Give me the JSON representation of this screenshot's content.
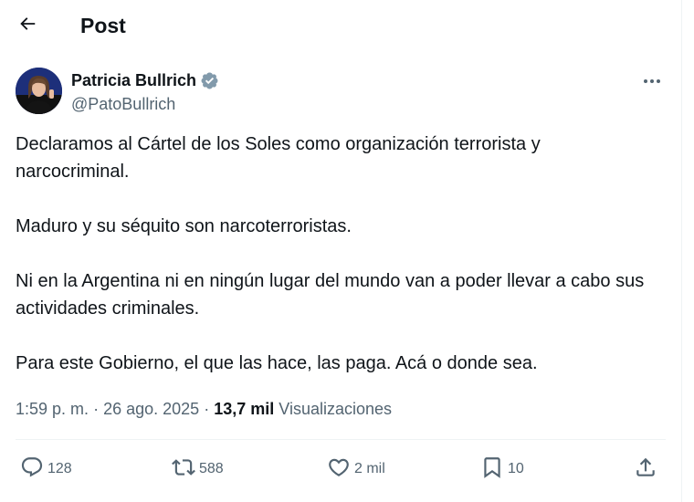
{
  "header": {
    "title": "Post"
  },
  "author": {
    "name": "Patricia Bullrich",
    "handle": "@PatoBullrich"
  },
  "tweet": {
    "paragraphs": [
      "Declaramos al Cártel de los Soles como organización terrorista y narcocriminal.",
      "Maduro y su séquito son narcoterroristas.",
      "Ni en la Argentina ni en ningún lugar del mundo van a poder llevar a cabo sus actividades criminales.",
      "Para este Gobierno, el que las hace, las paga. Acá o donde sea."
    ]
  },
  "meta": {
    "time": "1:59 p. m.",
    "separator": "·",
    "date": "26 ago. 2025",
    "views_count": "13,7 mil",
    "views_label": "Visualizaciones"
  },
  "actions": {
    "replies": "128",
    "reposts": "588",
    "likes": "2 mil",
    "bookmarks": "10"
  },
  "icons": {
    "back": "back-arrow-icon",
    "verified": "verified-badge-icon",
    "more": "more-dots-icon",
    "reply": "reply-icon",
    "repost": "repost-icon",
    "like": "heart-icon",
    "bookmark": "bookmark-icon",
    "share": "share-icon"
  },
  "colors": {
    "text_primary": "#0f1419",
    "text_secondary": "#536471",
    "verified_badge": "#829aab",
    "divider": "#eff3f4"
  }
}
